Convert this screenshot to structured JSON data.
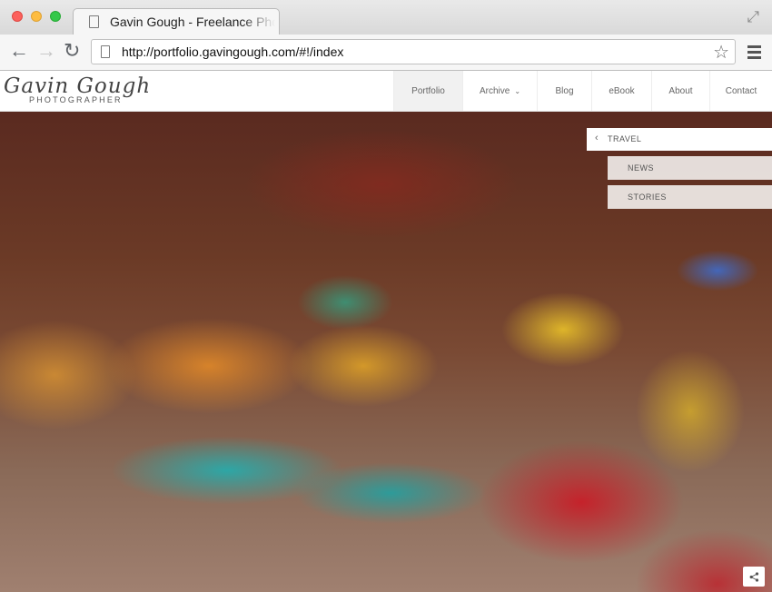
{
  "browser": {
    "tab_title": "Gavin Gough - Freelance Photographer",
    "url": "http://portfolio.gavingough.com/#!/index",
    "back_icon": "←",
    "forward_icon": "→",
    "reload_icon": "↻",
    "star_icon": "☆",
    "expand_icon": "⤢"
  },
  "site": {
    "logo_name": "Gavin Gough",
    "logo_sub": "PHOTOGRAPHER",
    "nav": [
      {
        "label": "Portfolio",
        "active": true
      },
      {
        "label": "Archive",
        "dropdown": true
      },
      {
        "label": "Blog"
      },
      {
        "label": "eBook"
      },
      {
        "label": "About"
      },
      {
        "label": "Contact"
      }
    ],
    "dropdown_icon": "⌄"
  },
  "submenu": {
    "back_icon": "‹",
    "parent": "TRAVEL",
    "items": [
      "NEWS",
      "STORIES"
    ]
  },
  "share_icon": "share-icon"
}
